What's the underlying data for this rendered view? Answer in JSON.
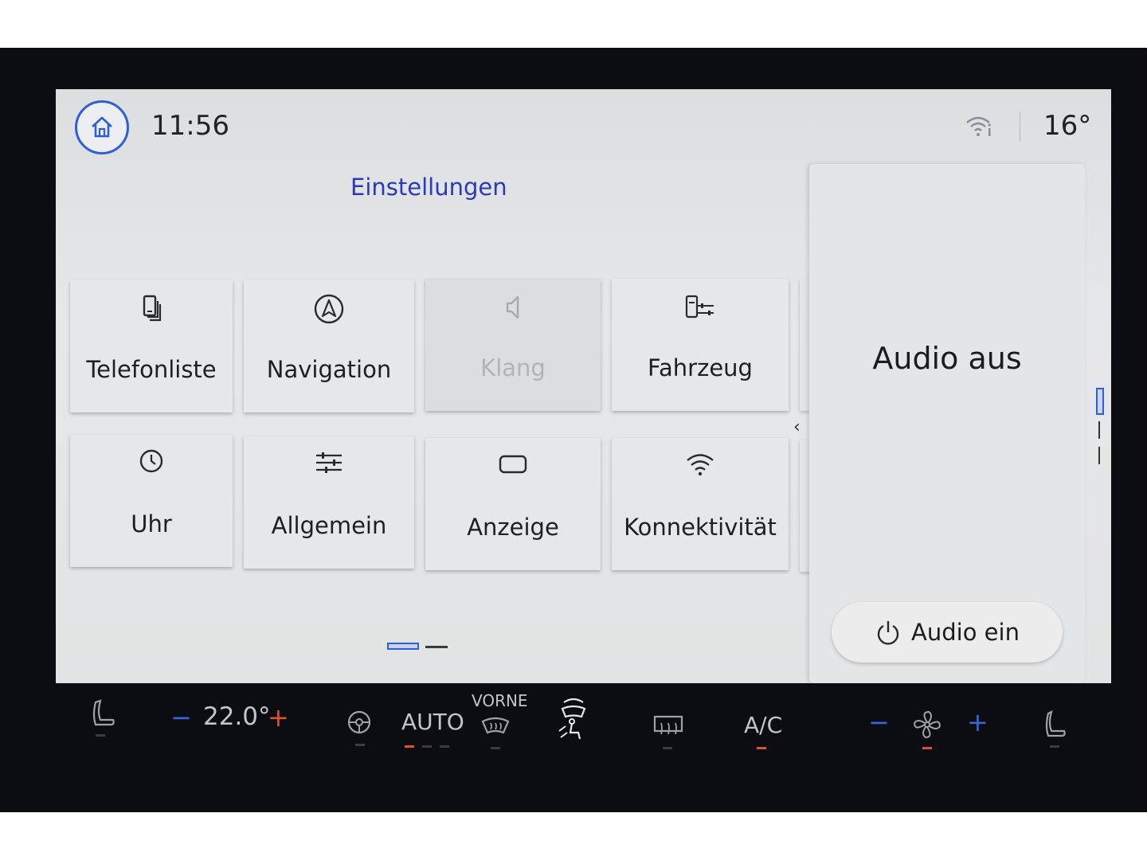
{
  "status_bar": {
    "time": "11:56",
    "temperature": "16°"
  },
  "page": {
    "title": "Einstellungen"
  },
  "tiles": [
    {
      "label": "Telefonliste",
      "icon": "phone-list-icon",
      "enabled": true
    },
    {
      "label": "Navigation",
      "icon": "navigation-icon",
      "enabled": true
    },
    {
      "label": "Klang",
      "icon": "speaker-icon",
      "enabled": false
    },
    {
      "label": "Fahrzeug",
      "icon": "vehicle-settings-icon",
      "enabled": true
    },
    {
      "label": "Uhr",
      "icon": "clock-icon",
      "enabled": true
    },
    {
      "label": "Allgemein",
      "icon": "sliders-icon",
      "enabled": true
    },
    {
      "label": "Anzeige",
      "icon": "display-icon",
      "enabled": true
    },
    {
      "label": "Konnektivität",
      "icon": "wifi-icon",
      "enabled": true
    }
  ],
  "pagination": {
    "current": 1,
    "total": 2
  },
  "audio_panel": {
    "title": "Audio aus",
    "button_label": "Audio ein"
  },
  "climate": {
    "driver_temp": "22.0°",
    "auto_label": "AUTO",
    "front_label": "VORNE",
    "ac_label": "A/C",
    "minus": "−",
    "plus": "+"
  },
  "colors": {
    "accent_blue": "#2f5fd6",
    "title_blue": "#2a3ab8",
    "active_indicator": "#d9542c"
  }
}
